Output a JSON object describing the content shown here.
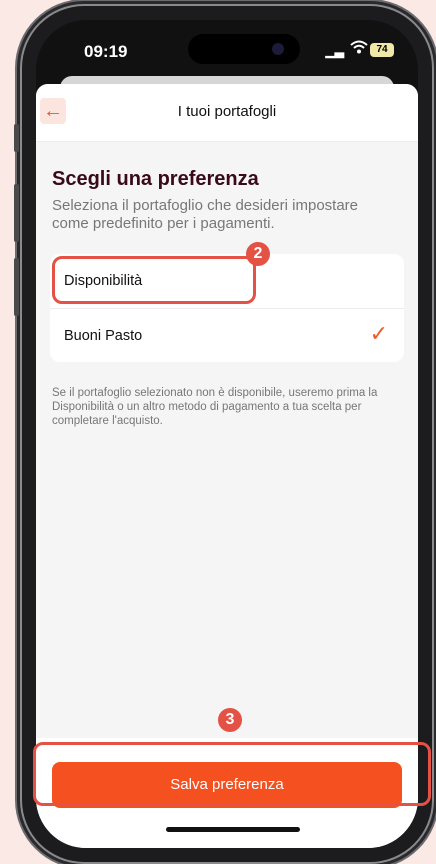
{
  "status_bar": {
    "time": "09:19",
    "battery": "74"
  },
  "header": {
    "back_icon": "arrow-left-icon",
    "title": "I tuoi portafogli"
  },
  "main": {
    "heading": "Scegli una preferenza",
    "subtitle": "Seleziona il portafoglio che desideri impostare come predefinito per i pagamenti.",
    "options": [
      {
        "label": "Disponibilità",
        "selected": false
      },
      {
        "label": "Buoni Pasto",
        "selected": true
      }
    ],
    "note": "Se il portafoglio selezionato non è disponibile, useremo prima la Disponibilità o un altro metodo di pagamento a tua scelta per completare l'acquisto."
  },
  "footer": {
    "save_label": "Salva preferenza"
  },
  "annotations": {
    "step_option": "2",
    "step_save": "3"
  },
  "colors": {
    "accent": "#f5501f",
    "annotation": "#e35244",
    "heading": "#3a0a1a"
  }
}
